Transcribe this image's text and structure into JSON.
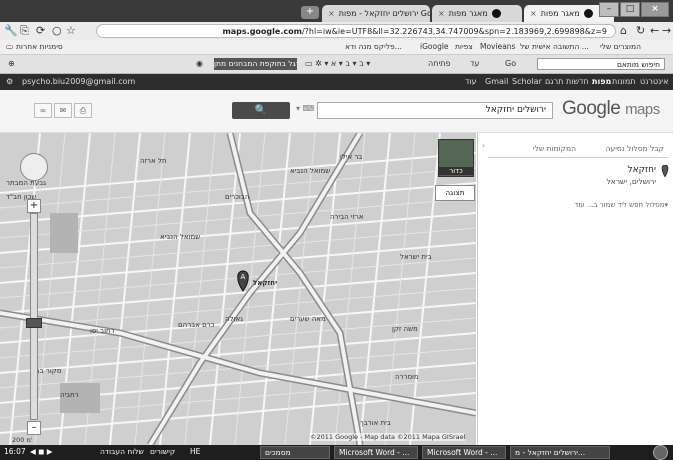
{
  "browser": {
    "tabs": [
      {
        "label": "מאגר מפות",
        "favicon": "black-circle"
      },
      {
        "label": "ירושלים יחזקאל - מפות Google",
        "favicon": "map-pin"
      },
      {
        "label": "מאגר מפות",
        "favicon": "black-circle"
      }
    ],
    "url_prefix": "maps.google.com",
    "url_rest": "/?hl=iw&ie=UTF8&ll=32.226743,34.747009&spn=2.183969,2.699898&z=9",
    "bookmarks": [
      {
        "label": "סימניות אחרות"
      },
      {
        "label": "המוצרים שלי"
      },
      {
        "label": "התשובה אישית של ..."
      },
      {
        "label": "Movieans"
      },
      {
        "label": "צפיות"
      },
      {
        "label": "iGoogle"
      },
      {
        "label": "פליקס מנה ודא..."
      }
    ],
    "toolbar": {
      "search_placeholder": "חיפוש מותאם",
      "go": "Go",
      "dark_label": "רגל בתוקפת המבחנים מתן",
      "items": [
        "פתיחה",
        "עד"
      ]
    }
  },
  "google_bar": {
    "account": "psycho.biu2009@gmail.com",
    "nav": [
      "אינטרנט",
      "תמונות",
      "מפות",
      "חדשות",
      "תרגם",
      "Scholar",
      "Gmail",
      "עוד"
    ]
  },
  "search": {
    "logo_main": "Google",
    "logo_sub": "maps",
    "query": "ירושלים יחזקאל",
    "button": "🔍"
  },
  "map": {
    "earth_label": "כדור",
    "type_label": "תצוגה",
    "copyright": "©2011 Google - Map data ©2011 Mapa GISrael",
    "scale": "200 מ'",
    "labels": [
      {
        "text": "הבוכרים"
      },
      {
        "text": "שמואל הנביא"
      },
      {
        "text": "ארזי הבירה"
      },
      {
        "text": "גבעת המבתר"
      },
      {
        "text": "כרם אברהם"
      },
      {
        "text": "גאולה"
      },
      {
        "text": "מאה שערים"
      },
      {
        "text": "רחביה"
      },
      {
        "text": "מוסררה"
      },
      {
        "text": "משה זקן"
      },
      {
        "text": "בית ישראל"
      },
      {
        "text": "בית אורבך"
      },
      {
        "text": "תל ארזה"
      },
      {
        "text": "מקור ברוך"
      },
      {
        "text": "בר אילן"
      },
      {
        "text": "יחזקאל"
      },
      {
        "text": "שמואל הנביא"
      },
      {
        "text": "רחוב יפו"
      },
      {
        "text": "שכון חב\"ד"
      }
    ]
  },
  "side": {
    "tabs": [
      "קבל מסלול נסיעה",
      "המקומות שלי"
    ],
    "place_name": "יחזקאל",
    "place_sub": "ירושלים, ישראל",
    "links": "מסלול  חפש ליד  שמור ב...  עוד▾"
  },
  "taskbar": {
    "time": "16:07",
    "lang": "HE",
    "items": [
      "ירושלים יחזקאל - מ...",
      "Microsoft Word - ...",
      "Microsoft Word - ...",
      "מסמכים"
    ],
    "tray": "שלוח העבודה",
    "tray2": "קישורים"
  }
}
